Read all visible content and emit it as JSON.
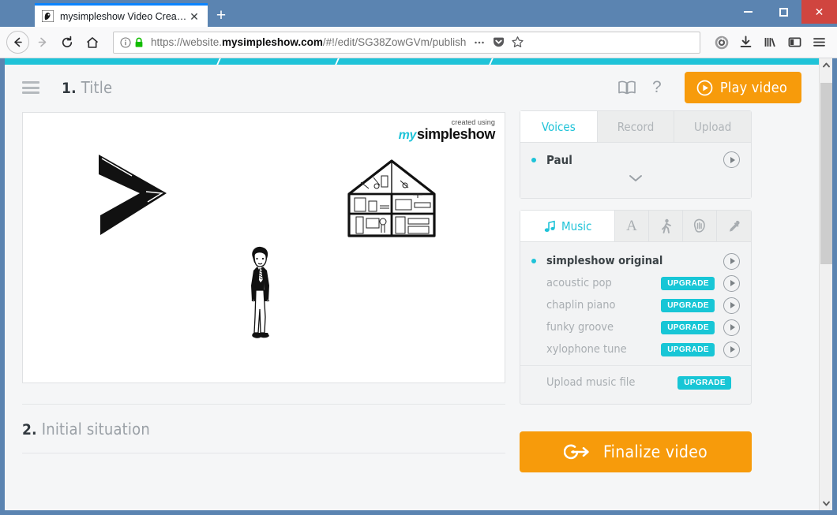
{
  "browser": {
    "tab": {
      "title": "mysimpleshow Video Creator",
      "favicon": "mysimpleshow-favicon",
      "close": "✕"
    },
    "newtab_label": "+",
    "window_controls": {
      "minimize": "minimize-icon",
      "maximize": "maximize-icon",
      "close": "✕"
    },
    "nav": {
      "back": "back-arrow-icon",
      "forward": "forward-arrow-icon",
      "reload": "reload-icon",
      "home": "home-icon"
    },
    "url": {
      "prefix": "https://website.",
      "domain": "mysimpleshow.com",
      "path": "/#!/edit/SG38ZowGVm/publish",
      "full": "https://website.mysimpleshow.com/#!/edit/SG38ZowGVm/publish",
      "identity_icon": "info-circle-icon",
      "lock_icon": "padlock-icon",
      "page_actions_icon": "ellipsis-icon",
      "pocket_icon": "pocket-icon",
      "bookmark_icon": "star-icon"
    },
    "toolbar_icons": [
      "sync-circle-icon",
      "downloads-icon",
      "library-icon",
      "sidebar-icon",
      "hamburger-menu-icon"
    ]
  },
  "app": {
    "progress_percent": 100,
    "menu_icon": "hamburger-menu-icon",
    "step": {
      "number": "1.",
      "title": "Title"
    },
    "header_icons": {
      "book": "book-icon",
      "help": "?"
    },
    "play_video_button": {
      "label": "Play video",
      "icon": "play-circle-icon",
      "color": "#f79b0b"
    }
  },
  "slide": {
    "watermark": {
      "line1": "created using",
      "brand_my": "my",
      "brand_name": "simpleshow"
    },
    "illustrations": [
      {
        "name": "greater-than-chevron",
        "alt": "hand drawn greater-than arrow"
      },
      {
        "name": "house-cross-section",
        "alt": "hand drawn cut-away house with rooms"
      },
      {
        "name": "businessman-figure",
        "alt": "hand drawn man in a suit"
      }
    ]
  },
  "next_section": {
    "number": "2.",
    "title": "Initial situation"
  },
  "voices_panel": {
    "tabs": [
      {
        "label": "Voices",
        "active": true
      },
      {
        "label": "Record",
        "active": false
      },
      {
        "label": "Upload",
        "active": false
      }
    ],
    "selected_voice": "Paul",
    "expand_icon": "chevron-down-icon",
    "preview_icon": "play-circle-icon"
  },
  "style_panel": {
    "tabs": [
      {
        "label": "Music",
        "icon": "music-note-icon",
        "active": true
      },
      {
        "label": "",
        "icon": "font-A-icon",
        "active": false
      },
      {
        "label": "",
        "icon": "walking-person-icon",
        "active": false
      },
      {
        "label": "",
        "icon": "hand-icon",
        "active": false
      },
      {
        "label": "",
        "icon": "eyedropper-icon",
        "active": false
      }
    ],
    "tracks": [
      {
        "name": "simpleshow original",
        "selected": true,
        "upgrade": ""
      },
      {
        "name": "acoustic pop",
        "selected": false,
        "upgrade": "UPGRADE"
      },
      {
        "name": "chaplin piano",
        "selected": false,
        "upgrade": "UPGRADE"
      },
      {
        "name": "funky groove",
        "selected": false,
        "upgrade": "UPGRADE"
      },
      {
        "name": "xylophone tune",
        "selected": false,
        "upgrade": "UPGRADE"
      }
    ],
    "upload": {
      "name": "Upload music file",
      "upgrade": "UPGRADE"
    },
    "accent_color": "#18c6d6"
  },
  "finalize_button": {
    "label": "Finalize video",
    "icon": "arrow-out-circle-icon",
    "color": "#f79b0b"
  },
  "scrollbar": {
    "up": "scroll-up-arrow",
    "down": "scroll-down-arrow"
  }
}
